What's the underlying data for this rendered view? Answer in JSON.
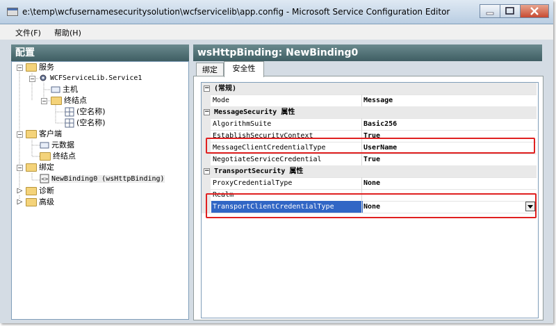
{
  "window": {
    "title": "e:\\temp\\wcfusernamesecuritysolution\\wcfservicelib\\app.config - Microsoft Service Configuration Editor"
  },
  "menu": {
    "file": "文件(F)",
    "help": "帮助(H)"
  },
  "left_pane": {
    "header": "配置",
    "tree": {
      "services": "服务",
      "service1": "WCFServiceLib.Service1",
      "host": "主机",
      "endpoints": "终结点",
      "unnamed1": "(空名称)",
      "unnamed2": "(空名称)",
      "client": "客户端",
      "metadata": "元数据",
      "client_endpoints": "终结点",
      "bindings": "绑定",
      "newbinding": "NewBinding0 (wsHttpBinding)",
      "diagnostics": "诊断",
      "advanced": "高级"
    }
  },
  "right_pane": {
    "header": "wsHttpBinding: NewBinding0",
    "tabs": [
      "绑定",
      "安全性"
    ],
    "grid": {
      "cat_general": "(常规)",
      "mode_name": "Mode",
      "mode_value": "Message",
      "cat_message": "MessageSecurity 属性",
      "algo_name": "AlgorithmSuite",
      "algo_value": "Basic256",
      "establish_name": "EstablishSecurityContext",
      "establish_value": "True",
      "mcct_name": "MessageClientCredentialType",
      "mcct_value": "UserName",
      "negotiate_name": "NegotiateServiceCredential",
      "negotiate_value": "True",
      "cat_transport": "TransportSecurity 属性",
      "proxy_name": "ProxyCredentialType",
      "proxy_value": "None",
      "realm_name": "Realm",
      "realm_value": "",
      "tcct_name": "TransportClientCredentialType",
      "tcct_value": "None"
    }
  },
  "colors": {
    "highlight_box": "#e02020",
    "selection": "#3166c5",
    "pane_header": "#4f6e73"
  }
}
